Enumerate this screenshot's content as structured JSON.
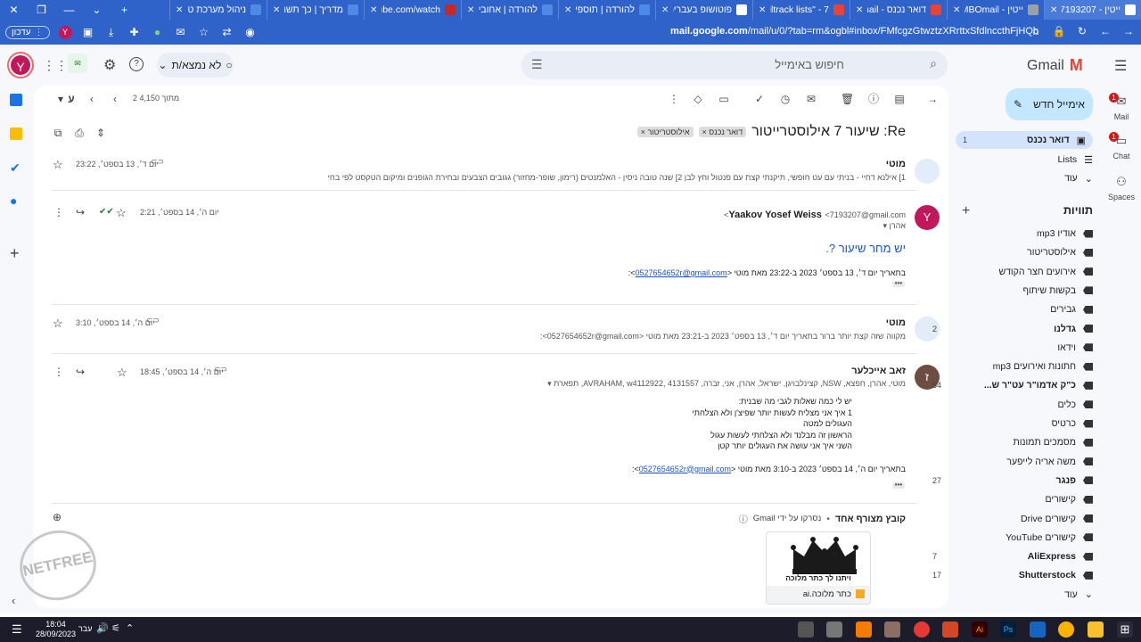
{
  "browser": {
    "tabs": [
      {
        "title": "ייטין - 7193207 :Re",
        "color": "#ffffff",
        "active": true
      },
      {
        "title": "ייטין - JUMBOmail",
        "color": "#9aa0a6"
      },
      {
        "title": "דואר נכנס - Gmail",
        "color": "#ea4335"
      },
      {
        "title": "mailtrack lists\" - 7\"",
        "color": "#ea4335"
      },
      {
        "title": "פוטושופ בעברית - 2",
        "color": "#ffffff"
      },
      {
        "title": "להורדה | תוספים",
        "color": "#4d8be6"
      },
      {
        "title": "להורדה | אחובי פוטו",
        "color": "#4d8be6"
      },
      {
        "title": "youtube.com/watch",
        "color": "#c62828"
      },
      {
        "title": "מדריך | כך תשנו א",
        "color": "#4d8be6"
      },
      {
        "title": "ניהול מערכת טלפו",
        "color": "#4d8be6"
      }
    ],
    "update_pill": "עדכון",
    "profile_letter": "Y",
    "url_domain": "mail.google.com",
    "url_rest": "/mail/u/0/?tab=rm&ogbl#inbox/FMfcgzGtwztzXRrttxSfdlnccthFjHQb"
  },
  "gmail": {
    "logo_text": "Gmail",
    "search_placeholder": "חיפוש באימייל",
    "status_label": "לא נמצא/ת",
    "account_letter": "Y",
    "compose_label": "אימייל חדש",
    "rail": [
      {
        "label": "Mail",
        "badge": "1"
      },
      {
        "label": "Chat",
        "badge": "1"
      },
      {
        "label": "Spaces",
        "badge": ""
      }
    ],
    "nav_primary": [
      {
        "label": "דואר נכנס",
        "count": "1",
        "bold": true,
        "active": true
      },
      {
        "label": "Lists",
        "count": ""
      },
      {
        "label": "עוד",
        "count": ""
      }
    ],
    "labels_heading": "תוויות",
    "labels": [
      {
        "label": "אודיו mp3",
        "count": "",
        "bold": false
      },
      {
        "label": "אילוסטריטור",
        "count": "",
        "bold": false
      },
      {
        "label": "אירועים חצר הקודש",
        "count": "",
        "bold": false
      },
      {
        "label": "בקשות שיתוף",
        "count": "",
        "bold": false
      },
      {
        "label": "גבירים",
        "count": "",
        "bold": false
      },
      {
        "label": "גדלנו",
        "count": "2",
        "bold": true
      },
      {
        "label": "וידאו",
        "count": "",
        "bold": false
      },
      {
        "label": "חתונות ואירועים mp3",
        "count": "",
        "bold": false
      },
      {
        "label": "כ\"ק אדמו\"ר עט\"ר ש...",
        "count": "54",
        "bold": true
      },
      {
        "label": "כלים",
        "count": "",
        "bold": false
      },
      {
        "label": "כרטיס",
        "count": "",
        "bold": false
      },
      {
        "label": "מסמכים תמונות",
        "count": "",
        "bold": false
      },
      {
        "label": "משה אריה לייפער",
        "count": "",
        "bold": false
      },
      {
        "label": "פנגר",
        "count": "27",
        "bold": true
      },
      {
        "label": "קישורים",
        "count": "",
        "bold": false
      },
      {
        "label": "קישורים Drive",
        "count": "",
        "bold": false
      },
      {
        "label": "קישורים YouTube",
        "count": "",
        "bold": false
      },
      {
        "label": "AliExpress",
        "count": "7",
        "bold": true
      },
      {
        "label": "Shutterstock",
        "count": "17",
        "bold": true
      },
      {
        "label": "עוד",
        "count": "",
        "bold": false
      }
    ],
    "pager": "2 מתוך 4,150",
    "lang_toggle": "ע",
    "thread": {
      "subject": "Re: שיעור 7 אילוסטרייטור",
      "labels": [
        "דואר נכנס",
        "אילוסטריטור"
      ],
      "messages": [
        {
          "sender": "מוטי",
          "date": "יום ד׳, 13 בספט׳, 23:22",
          "snippet": "1] אילנא דחיי - בניתי עם עט חופשי, תיקנתי קצת עם פנטול וחץ לבן 2] שנה טובה ניסין - האלמנטים (רימון, שופר-מחזור) גגובים הצבעים ובחירת הגופנים ומיקום הטקסט לפי בחי"
        },
        {
          "sender": "Yaakov Yosef Weiss",
          "email": "<7193207@gmail.com>",
          "to": "אהרן",
          "date": "יום ה׳, 14 בספט׳, 2:21",
          "body": "יש מחר שיעור ?.",
          "quote_prefix": "בתאריך יום ד׳, 13 בספט׳ 2023 ב-23:22 מאת מוטי <",
          "quote_link": "0527654652r@gmail.com",
          "quote_suffix": ">:",
          "avatar_letter": "Y"
        },
        {
          "sender": "מוטי",
          "date": "יום ה׳, 14 בספט׳, 3:10",
          "snippet": "מקווה שזה קצת יותר ברור בתאריך יום ד׳, 13 בספט׳ 2023 ב-23:21 מאת מוטי <0527654652r@gmail.com>:"
        },
        {
          "sender": "זאב אייכלער",
          "recipients": "מוטי, אהרן, חפצא, NSW, קצינלבויגן, ישראל, אהרן, אני, זברה, AVRAHAM, w4112922, 4131557, תפארת",
          "date": "יום ה׳, 14 בספט׳, 18:45",
          "avatar_letter": "ז",
          "body_lines": [
            "יש לי כמה שאלות לגבי מה שבנית:",
            "1 איך אני מצליח לעשות יותר שפיצ'ן ולא הצלחתי",
            "העגולים למטה",
            "הראשון זה מבלנד ולא הצלחתי לעשות עגול",
            "השני איך אני עושה את העגולים יותר קטן"
          ],
          "quote_prefix": "בתאריך יום ה׳, 14 בספט׳ 2023 ב-3:10 מאת מוטי <",
          "quote_link": "0527654652r@gmail.com",
          "quote_suffix": ">:"
        }
      ],
      "attachments_title": "קובץ מצורף אחד",
      "attachments_scan": "נסרקו על ידי Gmail",
      "attachment": {
        "name": "כתר מלוכה.ai",
        "caption": "ויתנו לך כתר מלוכה"
      }
    }
  },
  "stamp_text": "NETFREE",
  "taskbar": {
    "time": "18:04",
    "date": "28/09/2023",
    "lang": "עבר"
  }
}
